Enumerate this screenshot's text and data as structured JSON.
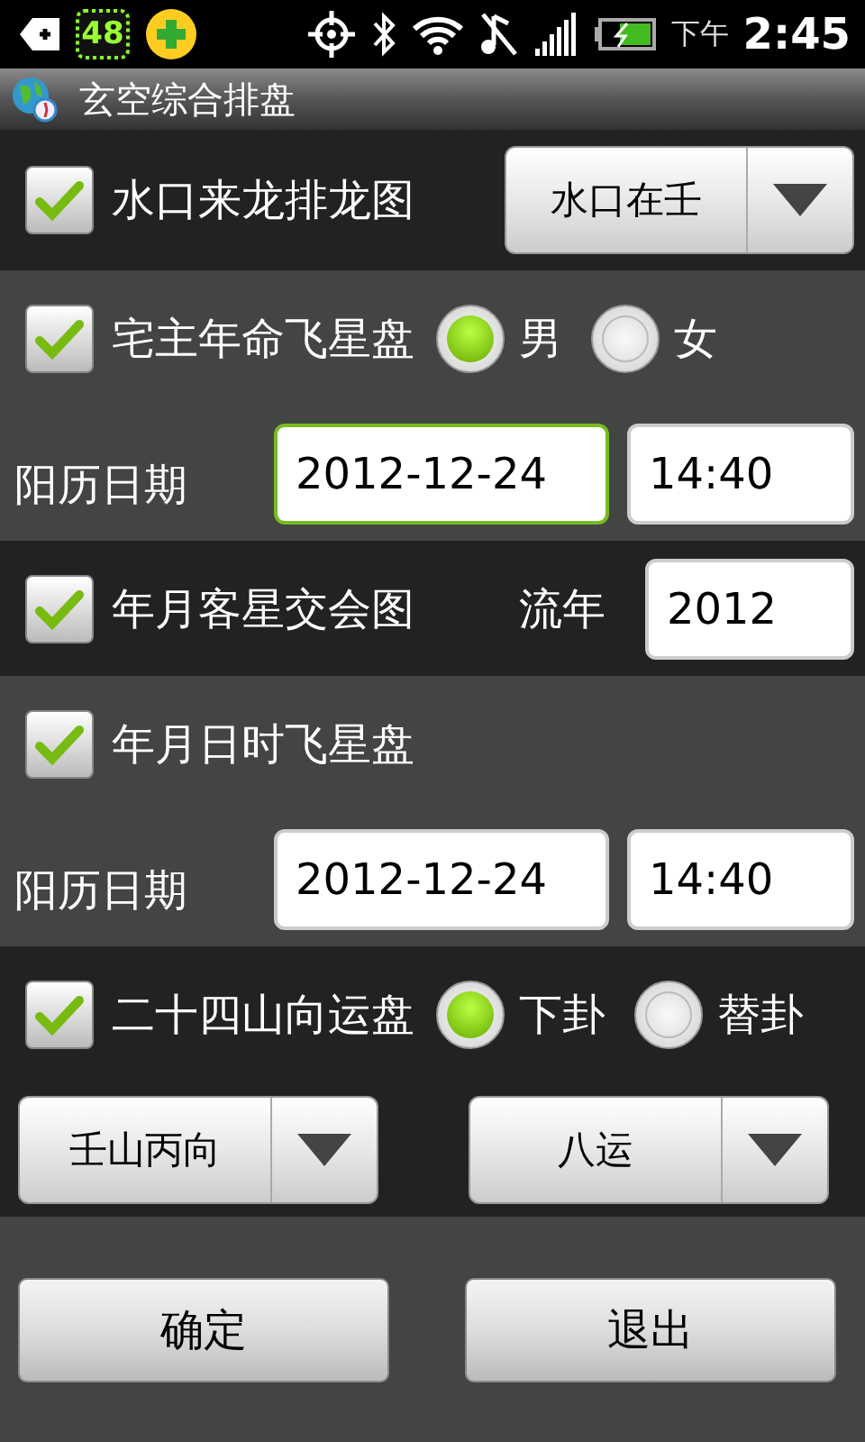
{
  "status_bar": {
    "badge": "48",
    "period": "下午",
    "time": "2:45"
  },
  "title": "玄空综合排盘",
  "sections": [
    {
      "rows": [
        {
          "kind": "check",
          "items": [
            {
              "kind": "checkbox",
              "label": "水口来龙排龙图",
              "checked": true
            },
            {
              "kind": "spinner",
              "value": "水口在壬"
            }
          ]
        }
      ]
    },
    {
      "rows": [
        {
          "kind": "check",
          "items": [
            {
              "kind": "checkbox",
              "label": "宅主年命飞星盘",
              "checked": true
            },
            {
              "kind": "radio",
              "label": "男",
              "selected": true
            },
            {
              "kind": "radio",
              "label": "女",
              "selected": false
            }
          ]
        },
        {
          "kind": "date",
          "items": [
            {
              "kind": "text",
              "label": "阳历日期"
            },
            {
              "kind": "field",
              "value": "2012-12-24",
              "focused": true
            },
            {
              "kind": "field",
              "value": "14:40",
              "focused": false
            }
          ]
        }
      ]
    },
    {
      "rows": [
        {
          "kind": "check",
          "items": [
            {
              "kind": "checkbox",
              "label": "年月客星交会图",
              "checked": true
            },
            {
              "kind": "text",
              "label": "流年"
            },
            {
              "kind": "field",
              "value": "2012",
              "focused": false
            }
          ]
        }
      ]
    },
    {
      "rows": [
        {
          "kind": "check",
          "items": [
            {
              "kind": "checkbox",
              "label": "年月日时飞星盘",
              "checked": true
            }
          ]
        },
        {
          "kind": "date",
          "items": [
            {
              "kind": "text",
              "label": "阳历日期"
            },
            {
              "kind": "field",
              "value": "2012-12-24",
              "focused": false
            },
            {
              "kind": "field",
              "value": "14:40",
              "focused": false
            }
          ]
        }
      ]
    },
    {
      "rows": [
        {
          "kind": "check",
          "items": [
            {
              "kind": "checkbox",
              "label": "二十四山向运盘",
              "checked": true
            },
            {
              "kind": "radio",
              "label": "下卦",
              "selected": true
            },
            {
              "kind": "radio",
              "label": "替卦",
              "selected": false
            }
          ]
        },
        {
          "kind": "spinners",
          "items": [
            {
              "kind": "spinner",
              "value": "壬山丙向"
            },
            {
              "kind": "spinner",
              "value": "八运"
            }
          ]
        }
      ]
    },
    {
      "rows": [
        {
          "kind": "buttons",
          "items": [
            {
              "kind": "button",
              "label": "确定"
            },
            {
              "kind": "button",
              "label": "退出"
            }
          ]
        }
      ]
    }
  ]
}
